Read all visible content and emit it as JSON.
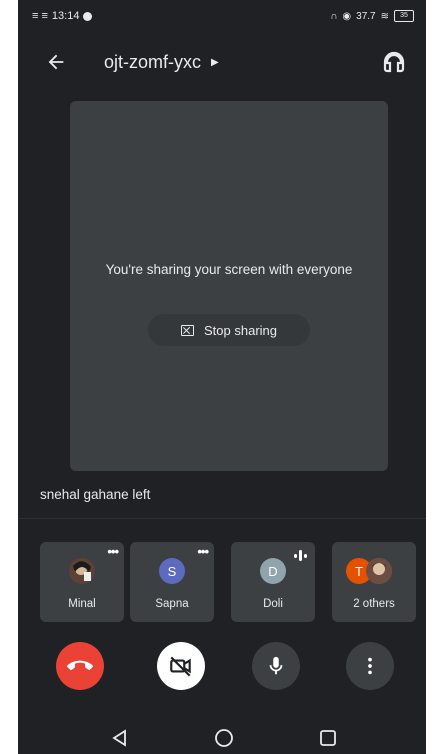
{
  "status_bar": {
    "time": "13:14",
    "signal_text": "≡ ≡",
    "network_text": "37.7",
    "battery": "35"
  },
  "header": {
    "meeting_code": "ojt-zomf-yxc"
  },
  "share": {
    "message": "You're sharing your screen with everyone",
    "stop_label": "Stop sharing"
  },
  "notice": "snehal gahane left",
  "participants": [
    {
      "name": "Minal",
      "avatar_type": "photo",
      "menu": "•••"
    },
    {
      "name": "Sapna",
      "initial": "S",
      "avatar_color": "#5c6bc0",
      "menu": "•••"
    },
    {
      "name": "Doli",
      "initial": "D",
      "avatar_color": "#90a4ae"
    },
    {
      "name": "2 others",
      "initial": "T",
      "avatar_color": "#e65100"
    }
  ],
  "controls": {
    "end_call_color": "#ea4335",
    "camera_bg": "#ffffff",
    "dark_bg": "#3c4043"
  },
  "colors": {
    "background": "#202124",
    "surface": "#3c4043",
    "text": "#e8eaed"
  }
}
